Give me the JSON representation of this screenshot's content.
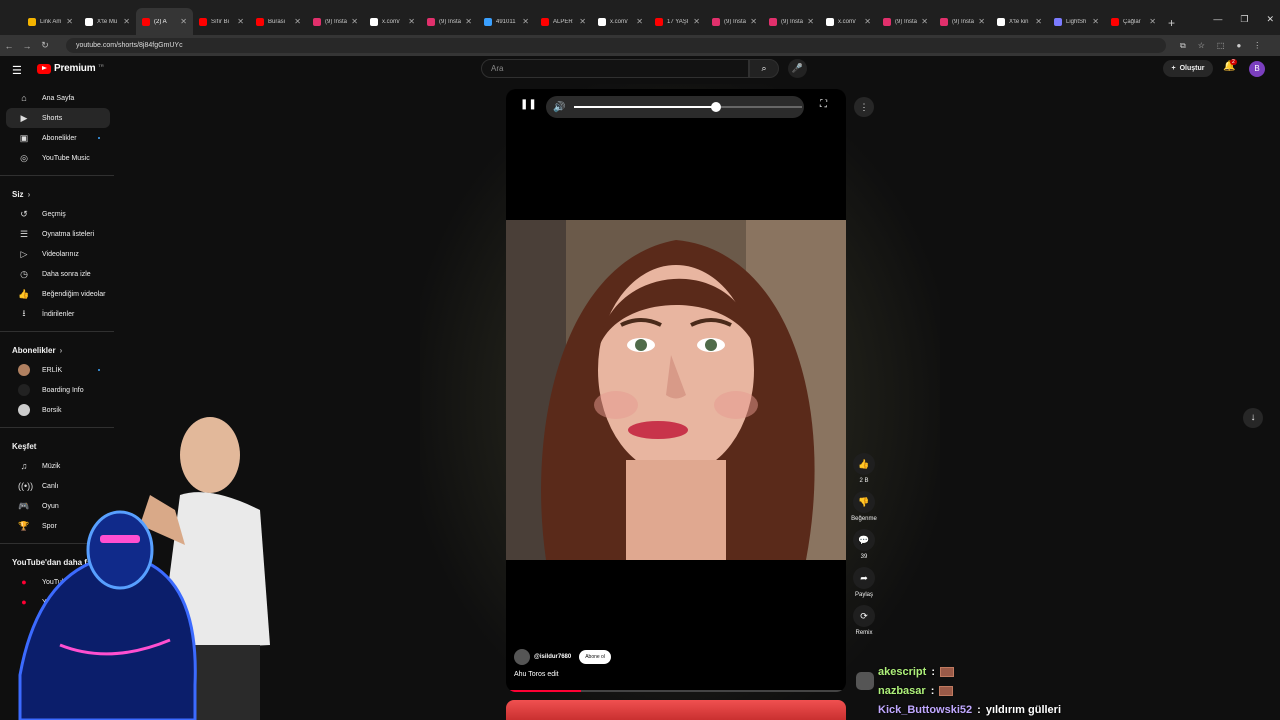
{
  "browser": {
    "tabs": [
      {
        "title": "Link Am",
        "color": "#f4b400",
        "active": false
      },
      {
        "title": "X'te Mü",
        "color": "#ffffff",
        "active": false
      },
      {
        "title": "(2) A",
        "color": "#ff0000",
        "active": true
      },
      {
        "title": "Sıfır Bi",
        "color": "#ff0000",
        "active": false
      },
      {
        "title": "Burası",
        "color": "#ff0000",
        "active": false
      },
      {
        "title": "(9) Insta",
        "color": "#e1306c",
        "active": false
      },
      {
        "title": "x.com/",
        "color": "#ffffff",
        "active": false
      },
      {
        "title": "(9) Insta",
        "color": "#e1306c",
        "active": false
      },
      {
        "title": "491011",
        "color": "#3aa0ff",
        "active": false
      },
      {
        "title": "ALPER",
        "color": "#ff0000",
        "active": false
      },
      {
        "title": "x.com/",
        "color": "#ffffff",
        "active": false
      },
      {
        "title": "17 YAŞI",
        "color": "#ff0000",
        "active": false
      },
      {
        "title": "(9) Insta",
        "color": "#e1306c",
        "active": false
      },
      {
        "title": "(9) Insta",
        "color": "#e1306c",
        "active": false
      },
      {
        "title": "x.com/",
        "color": "#ffffff",
        "active": false
      },
      {
        "title": "(9) Insta",
        "color": "#e1306c",
        "active": false
      },
      {
        "title": "(9) Insta",
        "color": "#e1306c",
        "active": false
      },
      {
        "title": "X'te kin",
        "color": "#ffffff",
        "active": false
      },
      {
        "title": "LightSh",
        "color": "#7b7bff",
        "active": false
      },
      {
        "title": "Çağlar",
        "color": "#ff0000",
        "active": false
      }
    ],
    "url": "youtube.com/shorts/8j84fgGmUYc"
  },
  "header": {
    "brand": "Premium",
    "brand_tag": "TR",
    "search_placeholder": "Ara",
    "create_label": "Oluştur",
    "notif_count": "2",
    "avatar_letter": "B"
  },
  "sidebar": {
    "main": [
      {
        "label": "Ana Sayfa",
        "icon": "⌂",
        "active": false
      },
      {
        "label": "Shorts",
        "icon": "▶",
        "active": true
      },
      {
        "label": "Abonelikler",
        "icon": "▣",
        "active": false,
        "dot": true
      },
      {
        "label": "YouTube Music",
        "icon": "◎",
        "active": false
      }
    ],
    "you_header": "Siz",
    "you": [
      {
        "label": "Geçmiş",
        "icon": "↺"
      },
      {
        "label": "Oynatma listeleri",
        "icon": "☰"
      },
      {
        "label": "Videolarınız",
        "icon": "▷"
      },
      {
        "label": "Daha sonra izle",
        "icon": "◷"
      },
      {
        "label": "Beğendiğim videolar",
        "icon": "👍"
      },
      {
        "label": "İndirilenler",
        "icon": "⭳"
      }
    ],
    "subs_header": "Abonelikler",
    "subs": [
      {
        "label": "ERLİK",
        "color": "#b08060",
        "dot": true
      },
      {
        "label": "Boarding Info",
        "color": "#222222"
      },
      {
        "label": "Borsik",
        "color": "#cccccc"
      }
    ],
    "explore_header": "Keşfet",
    "explore": [
      {
        "label": "Müzik",
        "icon": "♫"
      },
      {
        "label": "Canlı",
        "icon": "((•))"
      },
      {
        "label": "Oyun",
        "icon": "🎮"
      },
      {
        "label": "Spor",
        "icon": "🏆"
      }
    ],
    "more_header": "YouTube'dan daha fazla",
    "more": [
      {
        "label": "YouTube Studio"
      },
      {
        "label": "YouTube Music"
      }
    ]
  },
  "short": {
    "channel": "@isildur7680",
    "subscribe_label": "Abone ol",
    "title": "Ahu Toros edit",
    "volume": 0.62,
    "progress": 0.22
  },
  "actions": [
    {
      "icon": "👍",
      "label": "2 B",
      "name": "like"
    },
    {
      "icon": "👎",
      "label": "Beğenme",
      "name": "dislike"
    },
    {
      "icon": "💬",
      "label": "39",
      "name": "comments"
    },
    {
      "icon": "➦",
      "label": "Paylaş",
      "name": "share"
    },
    {
      "icon": "⟳",
      "label": "Remix",
      "name": "remix"
    }
  ],
  "chat": [
    {
      "user": "akescript",
      "msg": ""
    },
    {
      "user": "nazbasar",
      "msg": ""
    },
    {
      "user": "Kick_Buttowski52",
      "msg": "yıldırım gülleri"
    }
  ]
}
